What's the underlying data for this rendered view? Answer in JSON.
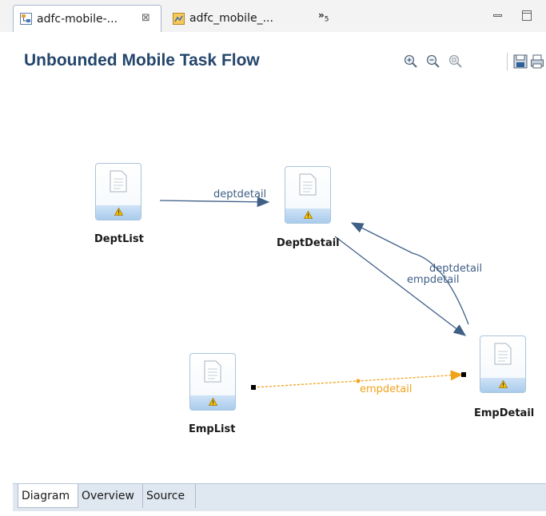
{
  "tabs": [
    {
      "label": "adfc-mobile-...",
      "active": true,
      "icon": "task-flow-diagram-icon"
    },
    {
      "label": "adfc_mobile_...",
      "active": false,
      "icon": "task-flow-file-icon"
    }
  ],
  "tab_overflow": {
    "label": "»",
    "count": "5"
  },
  "header": {
    "title": "Unbounded Mobile Task Flow"
  },
  "toolbar": [
    "zoom-in-icon",
    "zoom-out-icon",
    "zoom-fit-icon",
    "save-image-icon",
    "print-icon"
  ],
  "activities": [
    {
      "label": "DeptList"
    },
    {
      "label": "DeptDetail"
    },
    {
      "label": "EmpList"
    },
    {
      "label": "EmpDetail"
    }
  ],
  "edges": [
    {
      "label": "deptdetail",
      "from": "DeptList",
      "to": "DeptDetail"
    },
    {
      "label": "empdetail",
      "from": "DeptDetail",
      "to": "EmpDetail"
    },
    {
      "label": "deptdetail",
      "from": "EmpDetail",
      "to": "DeptDetail"
    },
    {
      "label": "empdetail",
      "from": "EmpList",
      "to": "EmpDetail",
      "selected": true
    }
  ],
  "bottom_tabs": [
    {
      "label": "Diagram",
      "active": true
    },
    {
      "label": "Overview",
      "active": false
    },
    {
      "label": "Source",
      "active": false
    }
  ],
  "colors": {
    "edge": "#3f5f86",
    "selected_edge": "#f0a21a",
    "title": "#25466b"
  }
}
